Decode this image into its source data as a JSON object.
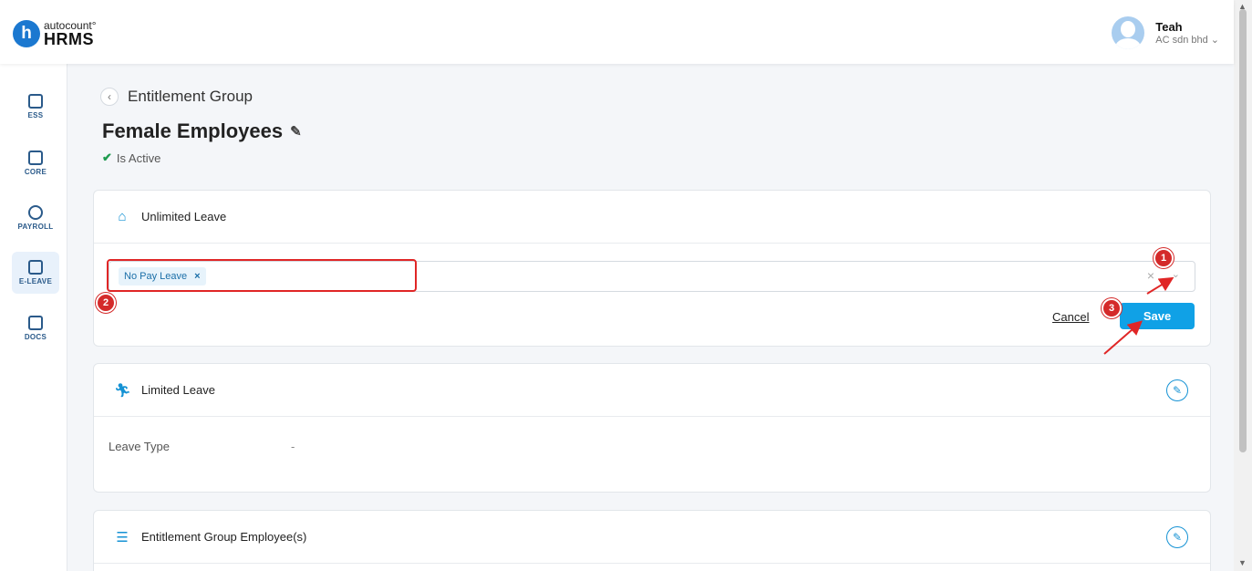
{
  "brand": {
    "sub": "autocount°",
    "main": "HRMS",
    "letter": "h"
  },
  "user": {
    "name": "Teah",
    "company": "AC sdn bhd ⌄"
  },
  "sidebar": {
    "items": [
      {
        "label": "ESS",
        "icon": "id-card-icon"
      },
      {
        "label": "CORE",
        "icon": "cube-icon"
      },
      {
        "label": "PAYROLL",
        "icon": "dollar-icon"
      },
      {
        "label": "E-LEAVE",
        "icon": "calendar-icon",
        "active": true
      },
      {
        "label": "DOCS",
        "icon": "document-chart-icon"
      }
    ]
  },
  "header": {
    "back_label": "Entitlement Group",
    "title": "Female Employees",
    "status": "Is Active"
  },
  "unlimited": {
    "title": "Unlimited Leave",
    "selected_tag": "No Pay Leave",
    "tag_remove": "×",
    "clear": "×",
    "cancel_label": "Cancel",
    "save_label": "Save"
  },
  "limited": {
    "title": "Limited Leave",
    "field_label": "Leave Type",
    "field_value": "-"
  },
  "employees": {
    "title": "Entitlement Group Employee(s)"
  },
  "annotations": {
    "m1": "1",
    "m2": "2",
    "m3": "3"
  },
  "colors": {
    "accent": "#10a1e6",
    "annotation": "#d42a2a",
    "active_green": "#1e9b4f"
  }
}
